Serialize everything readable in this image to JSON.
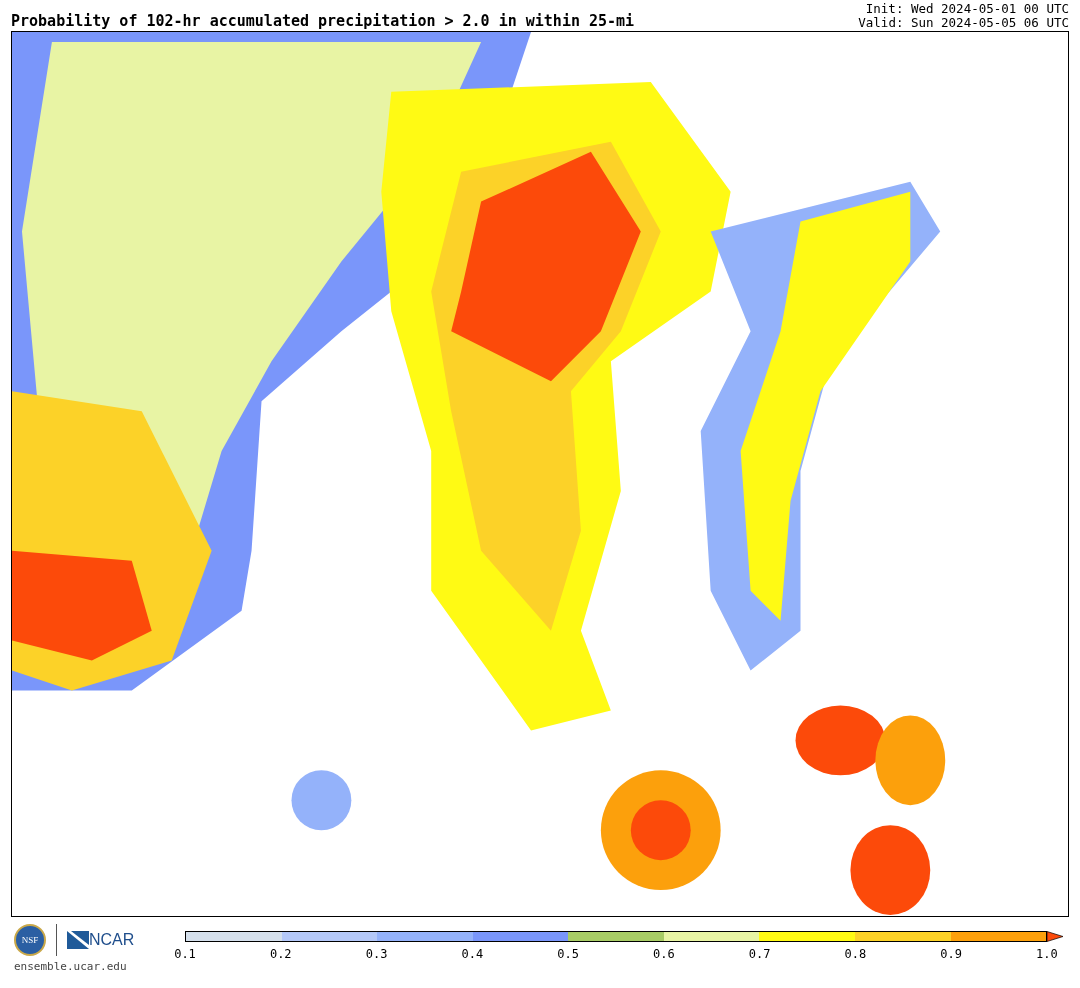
{
  "header": {
    "title": "Probability of 102-hr accumulated precipitation > 2.0 in within 25-mi",
    "init": "Init: Wed 2024-05-01 00 UTC",
    "valid": "Valid: Sun 2024-05-05 06 UTC"
  },
  "footer": {
    "logo_left": "NSF",
    "logo_right": "NCAR",
    "site": "ensemble.ucar.edu"
  },
  "colorbar": {
    "segments": [
      {
        "color": "#d5e0ec"
      },
      {
        "color": "#b4c8f8"
      },
      {
        "color": "#94b2fa"
      },
      {
        "color": "#7a96fa"
      },
      {
        "color": "#a8cc66"
      },
      {
        "color": "#e8f4a4"
      },
      {
        "color": "#fffa14"
      },
      {
        "color": "#fcd228"
      },
      {
        "color": "#fca00c"
      }
    ],
    "extension": {
      "color": "#fc4a0a"
    },
    "ticks": [
      "0.1",
      "0.2",
      "0.3",
      "0.4",
      "0.5",
      "0.6",
      "0.7",
      "0.8",
      "0.9",
      "1.0"
    ]
  }
}
